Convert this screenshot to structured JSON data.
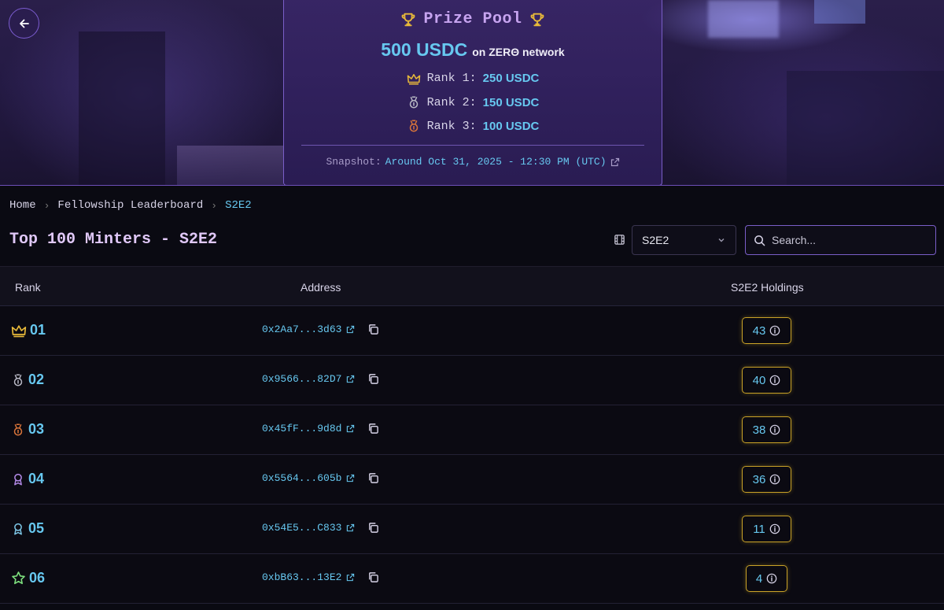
{
  "prize_pool": {
    "title": "Prize Pool",
    "amount": "500 USDC",
    "network": "on ZERΘ network",
    "ranks": [
      {
        "label": "Rank 1:",
        "value": "250 USDC",
        "icon": "crown-icon",
        "color": "#e8b93a"
      },
      {
        "label": "Rank 2:",
        "value": "150 USDC",
        "icon": "silver-medal-icon",
        "color": "#b8b8c4"
      },
      {
        "label": "Rank 3:",
        "value": "100 USDC",
        "icon": "bronze-medal-icon",
        "color": "#d9743a"
      }
    ],
    "snapshot_label": "Snapshot:",
    "snapshot_value": "Around Oct 31, 2025 - 12:30 PM (UTC)"
  },
  "breadcrumb": {
    "home": "Home",
    "leaderboard": "Fellowship Leaderboard",
    "current": "S2E2"
  },
  "page_title": "Top 100 Minters - S2E2",
  "season_select": {
    "value": "S2E2"
  },
  "search": {
    "placeholder": "Search..."
  },
  "table": {
    "headers": {
      "rank": "Rank",
      "address": "Address",
      "holdings": "S2E2 Holdings"
    },
    "rows": [
      {
        "rank": "01",
        "address": "0x2Aa7...3d63",
        "holdings": "43",
        "icon": "crown-icon",
        "color": "#e8b93a"
      },
      {
        "rank": "02",
        "address": "0x9566...82D7",
        "holdings": "40",
        "icon": "silver-medal-icon",
        "color": "#b8b8c4"
      },
      {
        "rank": "03",
        "address": "0x45fF...9d8d",
        "holdings": "38",
        "icon": "bronze-medal-icon",
        "color": "#d9743a"
      },
      {
        "rank": "04",
        "address": "0x5564...605b",
        "holdings": "36",
        "icon": "ribbon-icon",
        "color": "#b48ae8"
      },
      {
        "rank": "05",
        "address": "0x54E5...C833",
        "holdings": "11",
        "icon": "ribbon-icon",
        "color": "#7ec8e8"
      },
      {
        "rank": "06",
        "address": "0xbB63...13E2",
        "holdings": "4",
        "icon": "star-icon",
        "color": "#7ee07e"
      }
    ]
  }
}
